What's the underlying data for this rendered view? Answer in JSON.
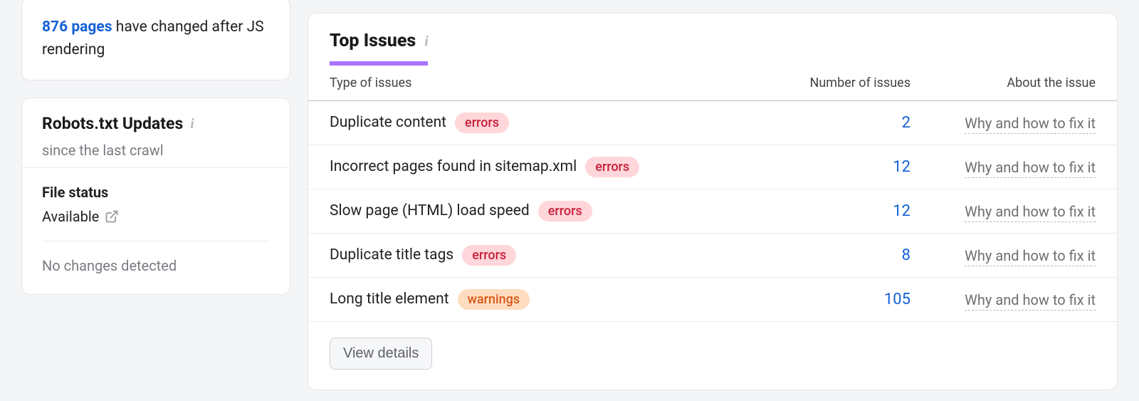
{
  "js_card": {
    "link_text": "876 pages",
    "rest_text": " have changed after JS rendering"
  },
  "robots": {
    "title": "Robots.txt Updates",
    "subtitle": "since the last crawl",
    "file_status_label": "File status",
    "file_status_value": "Available",
    "no_changes": "No changes detected"
  },
  "issues": {
    "title": "Top Issues",
    "headers": {
      "type": "Type of issues",
      "count": "Number of issues",
      "about": "About the issue"
    },
    "about_link": "Why and how to fix it",
    "view_details": "View details",
    "badge_labels": {
      "errors": "errors",
      "warnings": "warnings"
    },
    "rows": [
      {
        "name": "Duplicate content",
        "severity": "errors",
        "count": "2"
      },
      {
        "name": "Incorrect pages found in sitemap.xml",
        "severity": "errors",
        "count": "12"
      },
      {
        "name": "Slow page (HTML) load speed",
        "severity": "errors",
        "count": "12"
      },
      {
        "name": "Duplicate title tags",
        "severity": "errors",
        "count": "8"
      },
      {
        "name": "Long title element",
        "severity": "warnings",
        "count": "105"
      }
    ]
  }
}
